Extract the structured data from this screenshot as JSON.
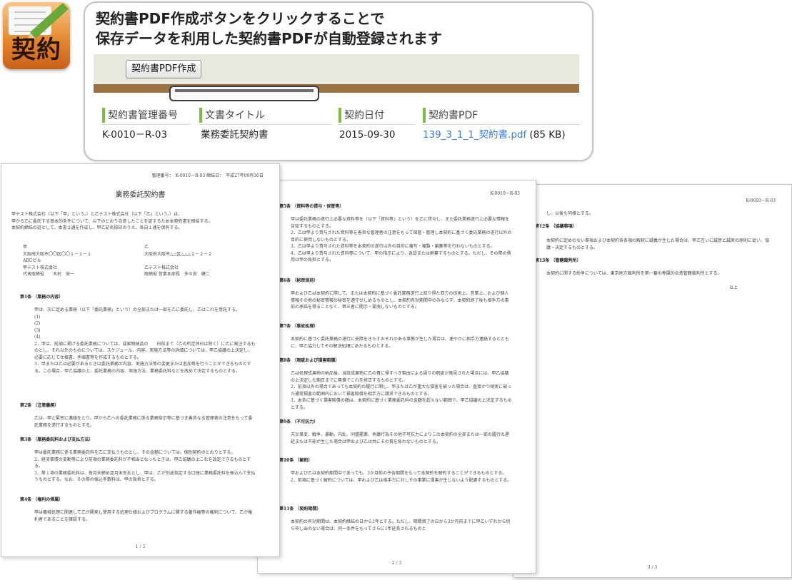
{
  "app_icon": {
    "label": "契約",
    "icon": "contract-pencil-icon"
  },
  "callout": {
    "line1": "契約書PDF作成ボタンをクリックすることで",
    "line2": "保存データを利用した契約書PDFが自動登録されます"
  },
  "toolbar": {
    "create_pdf_label": "契約書PDF作成"
  },
  "grid": {
    "headers": [
      "契約書管理番号",
      "文書タイトル",
      "契約日付",
      "契約書PDF"
    ],
    "row": {
      "number": "K-0010－R-03",
      "title": "業務委託契約書",
      "date": "2015-09-30",
      "pdf_link": "139_3_1_1_契約書.pdf",
      "pdf_size": "(85 KB)"
    }
  },
  "colors": {
    "accent_green": "#7bbf3f",
    "link_blue": "#3a7bd5",
    "bar_brown": "#9b7244"
  },
  "pages": {
    "p1": {
      "meta": "管理番号：　K-0010－R-03\n締結日：　平成27年09月30日",
      "title": "業務委託契約書",
      "intro": "甲テスト株式会社（以下「甲」という。）と乙テスト株式会社（以下「乙」という。）は、\n甲から乙に委託する基本的条件について、以下のとおり合意したことを証するため本契約書を締結する。\n本契約締結の証として、本書２通を作成し、甲乙記名捺印のうえ、各自１通を保有する。",
      "party_a": "甲\n大阪府大阪市〇〇区〇〇１－１－１\nABCビル\n甲テスト株式会社\n代表取締役　　木村　栄一",
      "party_b": "乙\n大阪府大阪市△△区△△△２－２－２\n\n乙テスト株式会社\n取締役 営業本部長　多々良　健二",
      "s1": "第1条 （業務の内容）",
      "s1_body": "甲は、次に定める業務（以下「委託業務」という）の全部または一部を乙に委託し、乙はこれを受託する。\n(1)\n(2)\n(3)\n(4)\n2．甲は、前項に掲げる委託業務については、成果物納品の　　日前まで（乙の所定休日は除く）に乙に発注するものとし、それ以外のものについては、スケジュール、内容、実施方法等の詳細については、甲乙協議の上決定し、必要に応じて仕様書、手順書等を作成するものとする。\n3．甲または乙は必要があるときは委託業務の内容、実施方法等の変更または追加等を行うことができるものとする。この場合、甲乙協議の上、委託業務の内容、実施方法、業務委託料などを改めて決定するものとする。",
      "s2": "第2条 （注意義務）",
      "s2_body": "乙は、甲と緊密に連絡をとり、甲から乙への委託業務に係る業務指示等に基づき善良なる管理者の注意をもって委託業務を遂行するものとする。",
      "s3": "第3条 （業務委託料および支払方法）",
      "s3_body": "甲は委託業務に係る業務委託料を乙に支払うものとし、その金額については、個別契約のとおりとする。\n2．経済事情の変動等により前項の業務委託料が不相当となったときは、甲乙協議の上これを改定できるものとする。\n3．第１項の業務委託料は、毎月末締め翌月末支払とし、甲は、乙が別途指定する口座に業務委託料を振込んで支払うものとする。なお、その際の振込手数料は、甲の負担とする。",
      "s4": "第4条 （権利の帰属）",
      "s4_body": "甲は機械処理に関連して乙が開発し使用する処理仕様およびプログラムに関する著作権等の権利について、乙が権利者であることを確認する。",
      "footer": "1 / 3"
    },
    "p2": {
      "meta": "K-0010－R-03",
      "s5": "第5条 （資料等の貸与・保管等）",
      "s5_body": "甲は委託業務の遂行上必要な資料等を（以下「資料等」という）を乙に貸与し、また委託業務遂行上必要な情報を告知するものとする。\n2．乙は甲より貸与された資料等を善良な管理者の注意をもって保管・管理し本契約に基づく委託業務の遂行以外の目的に使用しないものとする。\n3．乙は甲より貸与された資料等を本契約の遂行以外の目的に複写・複製・編集等を行わないものとする。\n4．乙は甲より貸与された資料等について、甲の指示により、返却または廃棄するものとする。ただし、その際の費用は甲の負担とする。",
      "s6": "第6条 （秘密保持）",
      "s6_body": "甲および乙は本契約に際して、または本契約に基づく委託業務遂行上知り得た双方の技術上、営業上、および個人情報その他の秘密情報の秘密を遵守せしめるものとし、本契約有効期間中のみならず、本契約終了後も相手方の事前の承諾を得ることなく、第三者に開示・漏洩しないものとする。",
      "s7": "第7条 （事故処理）",
      "s7_body": "本契約に基づく委託業務の遂行に支障をきたすおそれのある事態が生じた場合は、速やかに相手方連絡するとともに、甲乙協力してその解決処理にあたるものとする。",
      "s8": "第8条 （瑕疵および損害賠償）",
      "s8_body": "乙は処理成果物の納品後、当該成果物に乙の責に帰すべき事由による誤りの瑕疵が発見された場合には、甲乙協議の上決定した期日までに無償でこれを修正するものとする。\n2．前項以外の場合であっても本契約の履行に関し、甲または乙が重大な損害を被った場合は、直接かつ現実に被った通常損害の範囲内において損害賠償を相手方に請求できるものとする。\n3．本条に基づく損害賠償の額は、本契約に基づく業務委託料の金額を超えない範囲で、甲乙協議の上決定するものとする。",
      "s9": "第9条 （不可抗力）",
      "s9_body": "天災事変、戦争、暴動、内乱、同盟罷業、争議行為その他不可抗力によりこの本契約の全部または一部の履行の遅延または不能が生じた場合は甲および乙は共にその責を負わないものとする。",
      "s10": "第10条 （解約）",
      "s10_body": "甲および乙は本契約期間中であっても、3か月前の予告期間をもって本契約を解約することができるものとする。\n2．前項に基づく解約については、甲および乙は相手方に対しその事業に損害が生じないよう配慮するものとする。",
      "s11": "第11条 （契約期間）",
      "s11_body": "本契約の有効期間は、本契約締結の日から1年とする。ただし、期間満了の日から3か月前までに甲乙いずれから何ら申し出のない場合は、同一条件をもってさらに1年延長されるものと",
      "footer": "2 / 3"
    },
    "p3": {
      "meta": "K-0010－R-03",
      "lead": "し、以後も同様とする。",
      "s12": "第12条 （協議事項）",
      "s12_body": "本契約に定めのない事項および本契約各条項の解釈に疑義が生じた場合は、甲乙互いに誠意と誠実の原則に従い、協議・決定するものとする。",
      "s13": "第13条 （管轄裁判所）",
      "s13_body": "本契約に関する紛争については、東京地方裁判所を第一審の専属的合意管轄裁判所とする。",
      "end": "以上",
      "footer": "3 / 3"
    }
  }
}
